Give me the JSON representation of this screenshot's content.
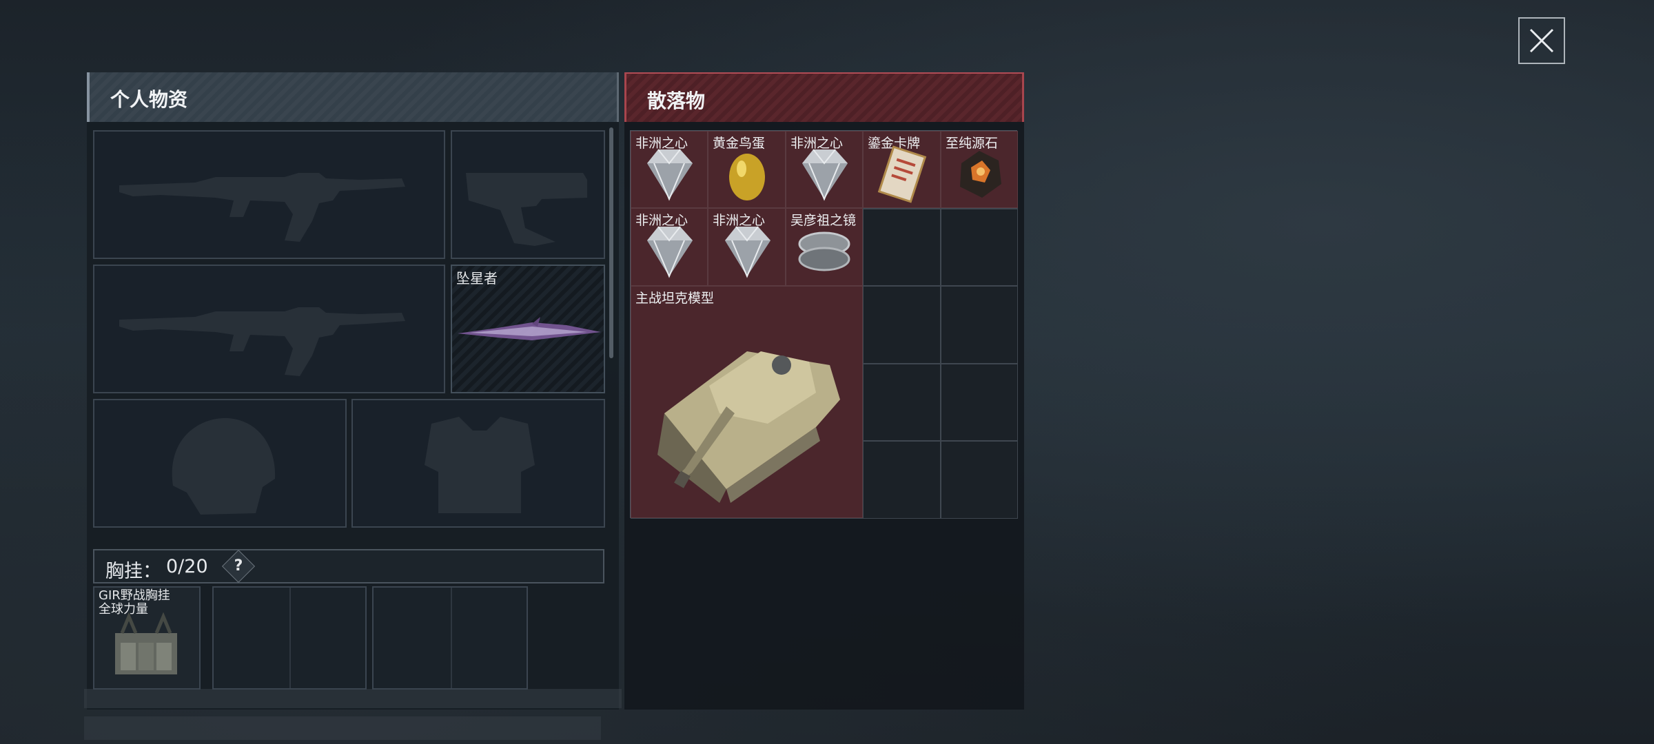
{
  "close_button": {
    "icon": "close-icon"
  },
  "personal": {
    "title": "个人物资",
    "weapons": [
      {
        "slot": "primary-1",
        "icon": "assault-rifle-icon",
        "name": ""
      },
      {
        "slot": "pistol",
        "icon": "pistol-icon",
        "name": ""
      },
      {
        "slot": "primary-2",
        "icon": "assault-rifle-icon",
        "name": ""
      },
      {
        "slot": "melee",
        "icon": "melee-blade-icon",
        "name": "坠星者"
      }
    ],
    "gear": [
      {
        "slot": "helmet",
        "icon": "helmet-icon"
      },
      {
        "slot": "armor",
        "icon": "armor-vest-icon"
      }
    ],
    "chest_rig": {
      "label": "胸挂：",
      "count": "0/20",
      "help": "?",
      "item_name": "GIR野战胸挂",
      "item_subname": "全球力量"
    }
  },
  "loot": {
    "title": "散落物",
    "items": [
      {
        "name": "非洲之心",
        "icon": "heart-diamond-icon"
      },
      {
        "name": "黄金鸟蛋",
        "icon": "golden-egg-icon"
      },
      {
        "name": "非洲之心",
        "icon": "heart-diamond-icon"
      },
      {
        "name": "鎏金卡牌",
        "icon": "gilded-card-icon"
      },
      {
        "name": "至纯源石",
        "icon": "source-stone-icon"
      },
      {
        "name": "非洲之心",
        "icon": "heart-diamond-icon"
      },
      {
        "name": "非洲之心",
        "icon": "heart-diamond-icon"
      },
      {
        "name": "吴彦祖之镜",
        "icon": "compact-mirror-icon"
      },
      {
        "name": "主战坦克模型",
        "icon": "tank-model-icon"
      }
    ]
  },
  "colors": {
    "loot_bg": "#4b262c",
    "header_red": "#5a262c",
    "accent_border": "#a8454d"
  }
}
